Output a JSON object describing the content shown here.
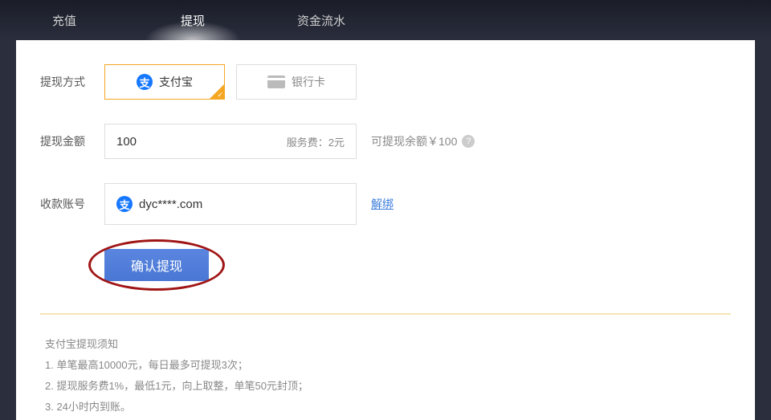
{
  "tabs": [
    {
      "label": "充值"
    },
    {
      "label": "提现"
    },
    {
      "label": "资金流水"
    }
  ],
  "form": {
    "method_label": "提现方式",
    "alipay_label": "支付宝",
    "alipay_icon_char": "支",
    "bankcard_label": "银行卡",
    "amount_label": "提现金额",
    "amount_value": "100",
    "fee_text": "服务费：2元",
    "balance_text": "可提现余额￥100",
    "help_char": "?",
    "account_label": "收款账号",
    "account_value": "dyc****.com",
    "unbind_label": "解绑",
    "confirm_label": "确认提现"
  },
  "notice": {
    "title": "支付宝提现须知",
    "line1": "1. 单笔最高10000元，每日最多可提现3次；",
    "line2": "2. 提现服务费1%，最低1元，向上取整，单笔50元封顶；",
    "line3": "3. 24小时内到账。"
  }
}
